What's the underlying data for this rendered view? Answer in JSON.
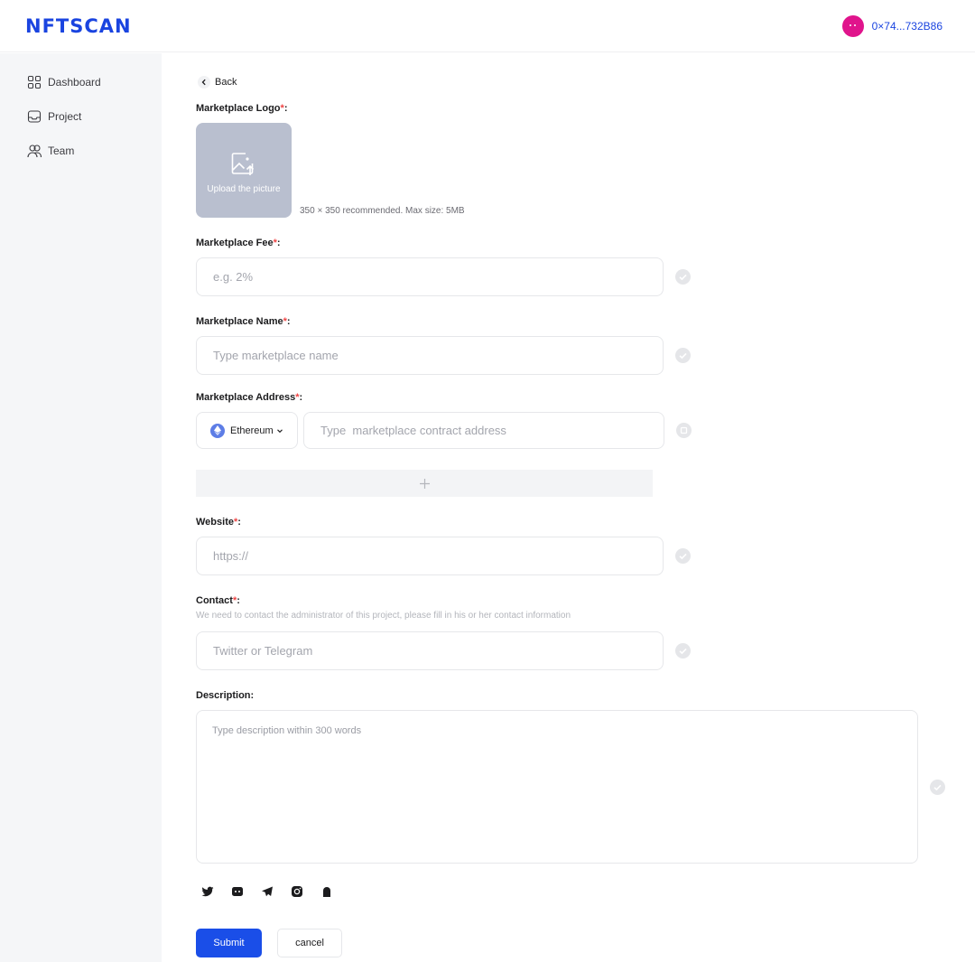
{
  "header": {
    "logo": "NFTSCAN",
    "account": "0×74...732B86",
    "brand_color": "#1a44e0"
  },
  "sidebar": {
    "items": [
      {
        "label": "Dashboard",
        "icon": "grid-icon"
      },
      {
        "label": "Project",
        "icon": "inbox-icon"
      },
      {
        "label": "Team",
        "icon": "users-icon"
      }
    ]
  },
  "form": {
    "back_label": "Back",
    "required_mark": "*",
    "logo": {
      "label": "Marketplace Logo",
      "colon": ":",
      "upload_text": "Upload the picture",
      "hint": "350 × 350 recommended. Max size: 5MB"
    },
    "fee": {
      "label": "Marketplace Fee",
      "colon": ":",
      "placeholder": "e.g. 2%"
    },
    "name": {
      "label": "Marketplace Name",
      "colon": ":",
      "placeholder": "Type marketplace name"
    },
    "address": {
      "label": "Marketplace Address",
      "colon": ":",
      "chain": "Ethereum",
      "placeholder": "Type  marketplace contract address"
    },
    "website": {
      "label": "Website",
      "colon": ":",
      "placeholder": "https://"
    },
    "contact": {
      "label": "Contact",
      "colon": ":",
      "sublabel": "We need to contact the administrator of this project, please fill in his or her contact information",
      "placeholder": "Twitter or Telegram"
    },
    "description": {
      "label": "Description:",
      "placeholder": "Type description within 300 words"
    },
    "socials": [
      "twitter-icon",
      "discord-icon",
      "telegram-icon",
      "instagram-icon",
      "medium-icon"
    ],
    "submit_label": "Submit",
    "cancel_label": "cancel"
  }
}
